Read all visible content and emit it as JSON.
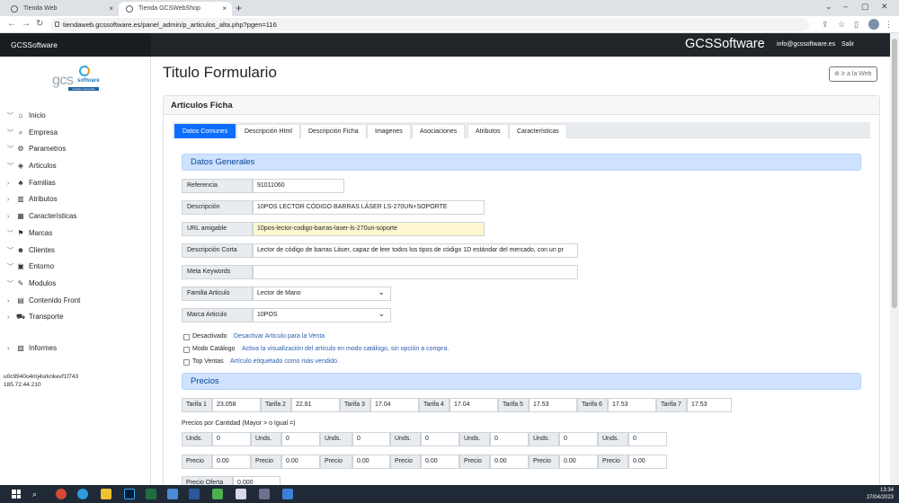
{
  "browser": {
    "tabs": [
      {
        "title": "Tienda Web",
        "close": "×"
      },
      {
        "title": "Tienda GCSWebShop",
        "close": "×"
      }
    ],
    "newtab": "+",
    "window_controls": [
      "⌄",
      "–",
      "▢",
      "✕"
    ],
    "url": "tiendaweb.gcssoftware.es/panel_admin/p_articulos_alta.php?pgen=116",
    "nav": {
      "back": "←",
      "forward": "→",
      "reload": "↻"
    }
  },
  "navbar": {
    "brand_left": "GCSSoftware",
    "brand_right": "GCSSoftware",
    "email": "info@gcssoftware.es",
    "logout": "Salir"
  },
  "logo": {
    "text": "gcs",
    "sub": "software",
    "bar": "Gestión Comercial"
  },
  "sidebar": {
    "items": [
      {
        "label": "Inicio",
        "chev": "﹀",
        "icon": "⌂",
        "name": "inicio"
      },
      {
        "label": "Empresa",
        "chev": "﹀",
        "icon": "⌕",
        "name": "empresa"
      },
      {
        "label": "Parametros",
        "chev": "﹀",
        "icon": "⚙",
        "name": "parametros"
      },
      {
        "label": "Articulos",
        "chev": "﹀",
        "icon": "◈",
        "name": "articulos"
      },
      {
        "label": "Familias",
        "chev": "›",
        "icon": "♣",
        "name": "familias"
      },
      {
        "label": "Atributos",
        "chev": "›",
        "icon": "▥",
        "name": "atributos"
      },
      {
        "label": "Características",
        "chev": "›",
        "icon": "▦",
        "name": "caracteristicas"
      },
      {
        "label": "Marcas",
        "chev": "﹀",
        "icon": "⚑",
        "name": "marcas"
      },
      {
        "label": "Clientes",
        "chev": "﹀",
        "icon": "☻",
        "name": "clientes"
      },
      {
        "label": "Entorno",
        "chev": "﹀",
        "icon": "▣",
        "name": "entorno"
      },
      {
        "label": "Modulos",
        "chev": "﹀",
        "icon": "✎",
        "name": "modulos"
      },
      {
        "label": "Contenido Front",
        "chev": "›",
        "icon": "▤",
        "name": "contenido-front"
      },
      {
        "label": "Transporte",
        "chev": "›",
        "icon": "⛟",
        "name": "transporte"
      }
    ],
    "extra": {
      "label": "Informes",
      "chev": "›",
      "icon": "▧"
    },
    "session_id": "u0c9940o4mj4srknkevf1f743",
    "ip": "185.72.44.210"
  },
  "page": {
    "title": "Titulo Formulario",
    "ir_web": "Ir a la Web",
    "ir_web_icon": "⊕",
    "card_title": "Articulos Ficha"
  },
  "tabs": [
    "Datos Comunes",
    "Descripción Html",
    "Descripción Ficha",
    "Imagenes",
    "Asociaciones",
    "Atributos",
    "Características"
  ],
  "datos_generales": {
    "title": "Datos Generales",
    "referencia": {
      "label": "Referencia",
      "value": "91011060"
    },
    "nombre": {
      "label": "Descripción",
      "value": "10POS LECTOR CÓDIGO BARRAS LÁSER LS-270UN+SOPORTE"
    },
    "url": {
      "label": "URL amigable",
      "value": "10pos-lector-codigo-barras-laser-ls-270un-soporte"
    },
    "desc_corta": {
      "label": "Descripción Corta",
      "value": "Lector de código de barras Láser, capaz de leer todos los tipos de código 1D estándar del mercado, con un pr"
    },
    "meta": {
      "label": "Meta Keywords",
      "value": ""
    },
    "familia": {
      "label": "Familia Articulo",
      "value": "Lector de Mano"
    },
    "marca": {
      "label": "Marca Articulo",
      "value": "10POS"
    },
    "checks": [
      {
        "label": "Desactivado",
        "hint": "Desactivar Articulo para la Venta"
      },
      {
        "label": "Modo Catálogo",
        "hint": "Activa la visualización del artículo en modo catálogo, sin opción a compra."
      },
      {
        "label": "Top Ventas",
        "hint": "Artículo etiquetado como más vendido."
      }
    ]
  },
  "precios": {
    "title": "Precios",
    "tarifas": [
      {
        "label": "Tarifa 1",
        "value": "23.058"
      },
      {
        "label": "Tarifa 2",
        "value": "22.81"
      },
      {
        "label": "Tarifa 3",
        "value": "17.04"
      },
      {
        "label": "Tarifa 4",
        "value": "17.04"
      },
      {
        "label": "Tarifa 5",
        "value": "17.53"
      },
      {
        "label": "Tarifa 6",
        "value": "17.53"
      },
      {
        "label": "Tarifa 7",
        "value": "17.53"
      }
    ],
    "cantidad_title": "Precios por Cantidad (Mayor > o Igual =)",
    "unds_label": "Unds.",
    "unds_values": [
      "0",
      "0",
      "0",
      "0",
      "0",
      "0",
      "0"
    ],
    "precio_label": "Precio",
    "precio_values": [
      "0.00",
      "0.00",
      "0.00",
      "0.00",
      "0.00",
      "0.00",
      "0.00"
    ],
    "oferta": {
      "label": "Precio Oferta",
      "value": "0.000"
    }
  },
  "taskbar": {
    "time": "13:34",
    "date": "27/04/2023"
  }
}
